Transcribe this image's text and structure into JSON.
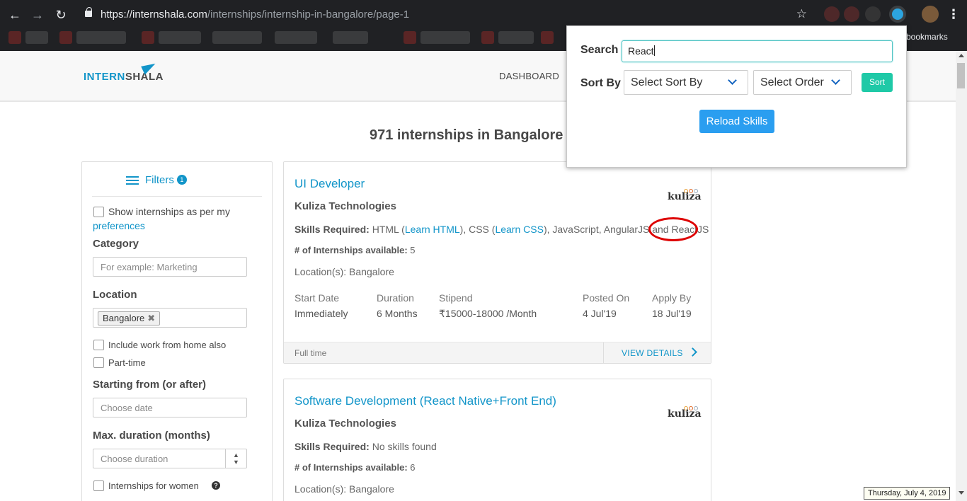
{
  "browser": {
    "url_host": "https://internshala.com",
    "url_path": "/internships/internship-in-bangalore/page-1",
    "other_bookmarks": "er bookmarks"
  },
  "header": {
    "logo_part1": "INTERN",
    "logo_part2": "SHALA",
    "nav_dashboard": "DASHBOARD"
  },
  "page_title": "971 internships in Bangalore",
  "filters": {
    "title": "Filters",
    "badge": "1",
    "show_pref": "Show internships as per my",
    "pref_link": "preferences",
    "category_label": "Category",
    "category_placeholder": "For example: Marketing",
    "location_label": "Location",
    "location_tag": "Bangalore",
    "wfh": "Include work from home also",
    "part_time": "Part-time",
    "starting_label": "Starting from (or after)",
    "starting_placeholder": "Choose date",
    "duration_label": "Max. duration (months)",
    "duration_placeholder": "Choose duration",
    "women": "Internships for women"
  },
  "internships": [
    {
      "title": "UI Developer",
      "company": "Kuliza Technologies",
      "logo": "kuliza",
      "skills_label": "Skills Required:",
      "skills_a": " HTML (",
      "learn_html": "Learn HTML",
      "skills_b": "), CSS (",
      "learn_css": "Learn CSS",
      "skills_c": "), JavaScript, AngularJS and ",
      "skills_d": "ReactJS",
      "count_label": "# of Internships available:",
      "count": " 5",
      "location": "Location(s): Bangalore",
      "start_label": "Start Date",
      "start": "Immediately",
      "duration_label": "Duration",
      "duration": "6 Months",
      "stipend_label": "Stipend",
      "stipend": "₹15000-18000 /Month",
      "posted_label": "Posted On",
      "posted": "4 Jul'19",
      "apply_label": "Apply By",
      "apply": "18 Jul'19",
      "type": "Full time",
      "view": "VIEW DETAILS"
    },
    {
      "title": "Software Development (React Native+Front End)",
      "company": "Kuliza Technologies",
      "logo": "kuliza",
      "skills_label": "Skills Required:",
      "skills": " No skills found",
      "count_label": "# of Internships available:",
      "count": " 6",
      "location": "Location(s): Bangalore"
    }
  ],
  "popup": {
    "search_label": "Search",
    "search_value": "React",
    "sort_label": "Sort By",
    "sort_by": "Select Sort By",
    "order": "Select Order",
    "sort_button": "Sort",
    "reload_button": "Reload Skills"
  },
  "date_tooltip": "Thursday, July 4, 2019",
  "colors": {
    "brand": "#1295c9",
    "sort_button": "#1fc9a7",
    "reload_button": "#2a9ef0",
    "highlight": "#dd0000"
  }
}
